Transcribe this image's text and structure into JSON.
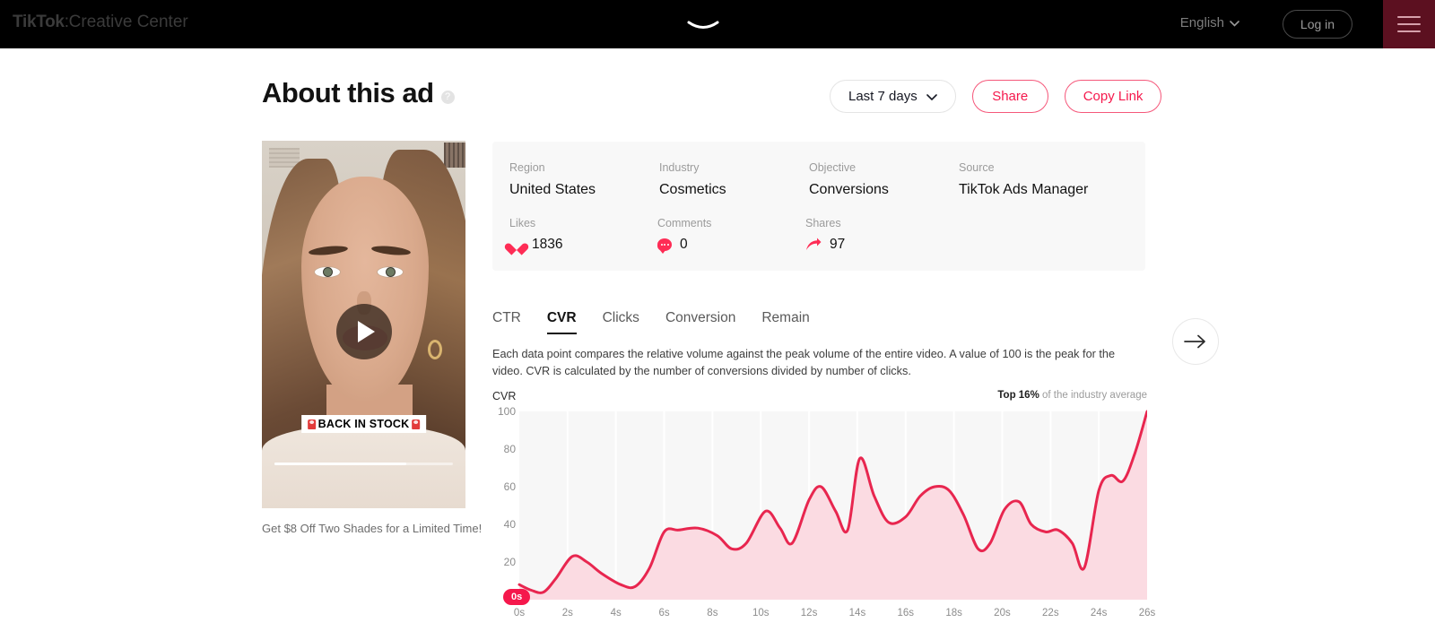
{
  "topnav": {
    "brand_name": "TikTok",
    "brand_separator": ":",
    "brand_sub": "Creative Center",
    "language": "English",
    "language_chevron": "chevron-down-icon",
    "login_label": "Log in",
    "menu_icon": "hamburger-menu-icon",
    "drag_handle_icon": "drag-handle-icon",
    "menu_color": "#5c1020"
  },
  "header": {
    "title": "About this ad",
    "help_icon": "question-mark-icon",
    "date_filter": "Last 7 days",
    "date_chevron": "chevron-down-icon",
    "share_label": "Share",
    "copy_link_label": "Copy Link",
    "accent_color": "#f5184c"
  },
  "video": {
    "overlay_text": "BACK IN STOCK",
    "overlay_icon": "siren-emoji",
    "play_icon": "play-icon",
    "caption": "Get $8 Off Two Shades for a Limited Time!"
  },
  "info_card": {
    "meta": [
      {
        "label": "Region",
        "value": "United States"
      },
      {
        "label": "Industry",
        "value": "Cosmetics"
      },
      {
        "label": "Objective",
        "value": "Conversions"
      },
      {
        "label": "Source",
        "value": "TikTok Ads Manager"
      }
    ],
    "stats": [
      {
        "label": "Likes",
        "value": "1836",
        "icon": "heart-icon"
      },
      {
        "label": "Comments",
        "value": "0",
        "icon": "comment-bubble-icon"
      },
      {
        "label": "Shares",
        "value": "97",
        "icon": "share-arrow-icon"
      }
    ]
  },
  "tabs": [
    {
      "label": "CTR",
      "active": false
    },
    {
      "label": "CVR",
      "active": true
    },
    {
      "label": "Clicks",
      "active": false
    },
    {
      "label": "Conversion",
      "active": false
    },
    {
      "label": "Remain",
      "active": false
    }
  ],
  "chart_description": "Each data point compares the relative volume against the peak volume of the entire video. A value of 100 is the peak for the video. CVR is calculated by the number of conversions divided by number of clicks.",
  "benchmark": {
    "rank": "Top 16%",
    "suffix": " of the industry average"
  },
  "playhead_badge": "0s",
  "next_button_icon": "arrow-right-icon",
  "chart_data": {
    "type": "area",
    "title": "CVR",
    "xlabel": "",
    "ylabel": "CVR",
    "xlim": [
      0,
      26
    ],
    "ylim": [
      0,
      100
    ],
    "grid": "vertical",
    "legend": "none",
    "line_color": "#e8264f",
    "fill_color": "#fbdbe2",
    "plot_bg": "#f7f7f7",
    "xticks": [
      "0s",
      "2s",
      "4s",
      "6s",
      "8s",
      "10s",
      "12s",
      "14s",
      "16s",
      "18s",
      "20s",
      "22s",
      "24s",
      "26s"
    ],
    "xtick_values": [
      0,
      2,
      4,
      6,
      8,
      10,
      12,
      14,
      16,
      18,
      20,
      22,
      24,
      26
    ],
    "yticks": [
      0,
      20,
      40,
      60,
      80,
      100
    ],
    "x": [
      0,
      0.5,
      1,
      1.5,
      2.2,
      2.8,
      3.4,
      4.2,
      4.8,
      5.4,
      6,
      6.6,
      7.4,
      8.2,
      8.8,
      9.4,
      10.2,
      10.8,
      11.3,
      12,
      12.5,
      13.1,
      13.6,
      14.1,
      14.7,
      15.3,
      16,
      16.6,
      17.2,
      17.8,
      18.4,
      19,
      19.5,
      20.1,
      20.7,
      21.2,
      21.8,
      22.3,
      22.9,
      23.4,
      24,
      24.5,
      25,
      25.5,
      26
    ],
    "y": [
      8,
      5,
      4,
      11,
      23,
      20,
      14,
      8,
      7,
      17,
      36,
      37,
      38,
      34,
      27,
      30,
      47,
      38,
      30,
      53,
      60,
      47,
      37,
      75,
      55,
      41,
      44,
      55,
      60,
      58,
      45,
      27,
      30,
      48,
      52,
      40,
      36,
      37,
      30,
      17,
      58,
      66,
      63,
      78,
      100
    ]
  }
}
